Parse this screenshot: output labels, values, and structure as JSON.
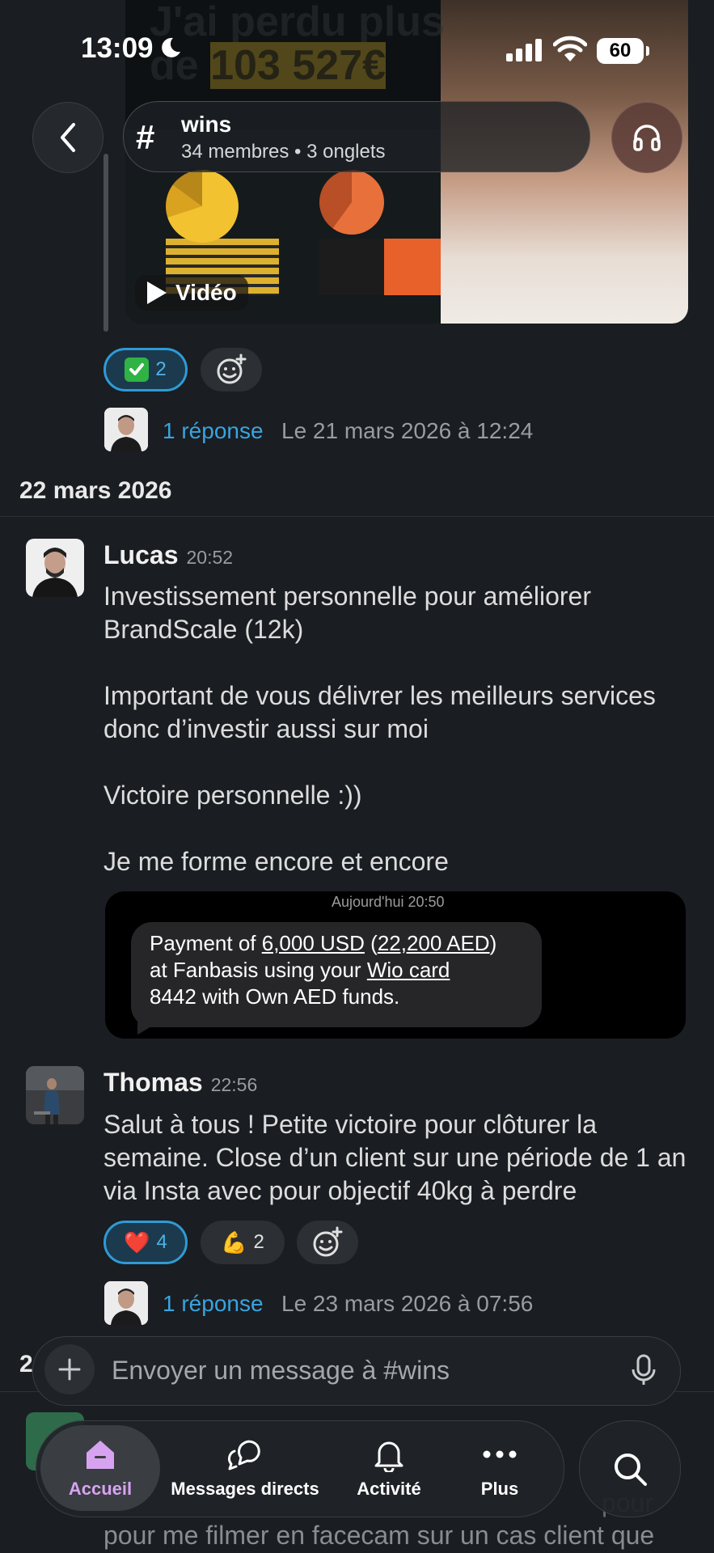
{
  "status_bar": {
    "time": "13:09",
    "battery": "60"
  },
  "video": {
    "overlay_line1": "J'ai perdu plus",
    "overlay_line2_prefix": "de ",
    "overlay_amount": "103 527€",
    "label": "Vidéo"
  },
  "header": {
    "channel_name": "wins",
    "subtitle": "34 membres • 3 onglets"
  },
  "post1": {
    "reaction": {
      "count": "2"
    },
    "reply": {
      "link": "1 réponse",
      "date": "Le 21 mars 2026 à 12:24"
    }
  },
  "day_separator": "22 mars 2026",
  "messages": [
    {
      "author": "Lucas",
      "time": "20:52",
      "paragraphs": [
        "Investissement personnelle pour améliorer BrandScale (12k)",
        "Important de vous délivrer les meilleurs services donc d’investir aussi sur moi",
        "Victoire personnelle :))",
        "Je me forme encore et encore"
      ],
      "attachment": {
        "date": "Aujourd'hui 20:50",
        "t1": "Payment of ",
        "amount_usd": "6,000 USD",
        "t2": " (",
        "amount_aed": "22,200 AED",
        "t3": ")",
        "t4": "at Fanbasis using your ",
        "card": "Wio card",
        "t5": "8442 with Own AED funds."
      }
    },
    {
      "author": "Thomas",
      "time": "22:56",
      "text": "Salut à tous ! Petite victoire pour clôturer la semaine. Close d’un client sur une période de 1 an via Insta avec pour objectif 40kg à perdre",
      "reactions": [
        {
          "emoji": "❤️",
          "count": "4"
        },
        {
          "emoji": "💪",
          "count": "2"
        }
      ],
      "reply": {
        "link": "1 réponse",
        "date": "Le 23 mars 2026 à 07:56"
      }
    }
  ],
  "composer": {
    "placeholder": "Envoyer un message à #wins"
  },
  "partial_bg": {
    "day_digit": "2",
    "line1_end": "pour",
    "line2": "pour me filmer en facecam sur un cas client que"
  },
  "nav": {
    "items": [
      {
        "label": "Accueil"
      },
      {
        "label": "Messages directs"
      },
      {
        "label": "Activité"
      },
      {
        "label": "Plus"
      }
    ],
    "accent": "#d7a3f0"
  }
}
